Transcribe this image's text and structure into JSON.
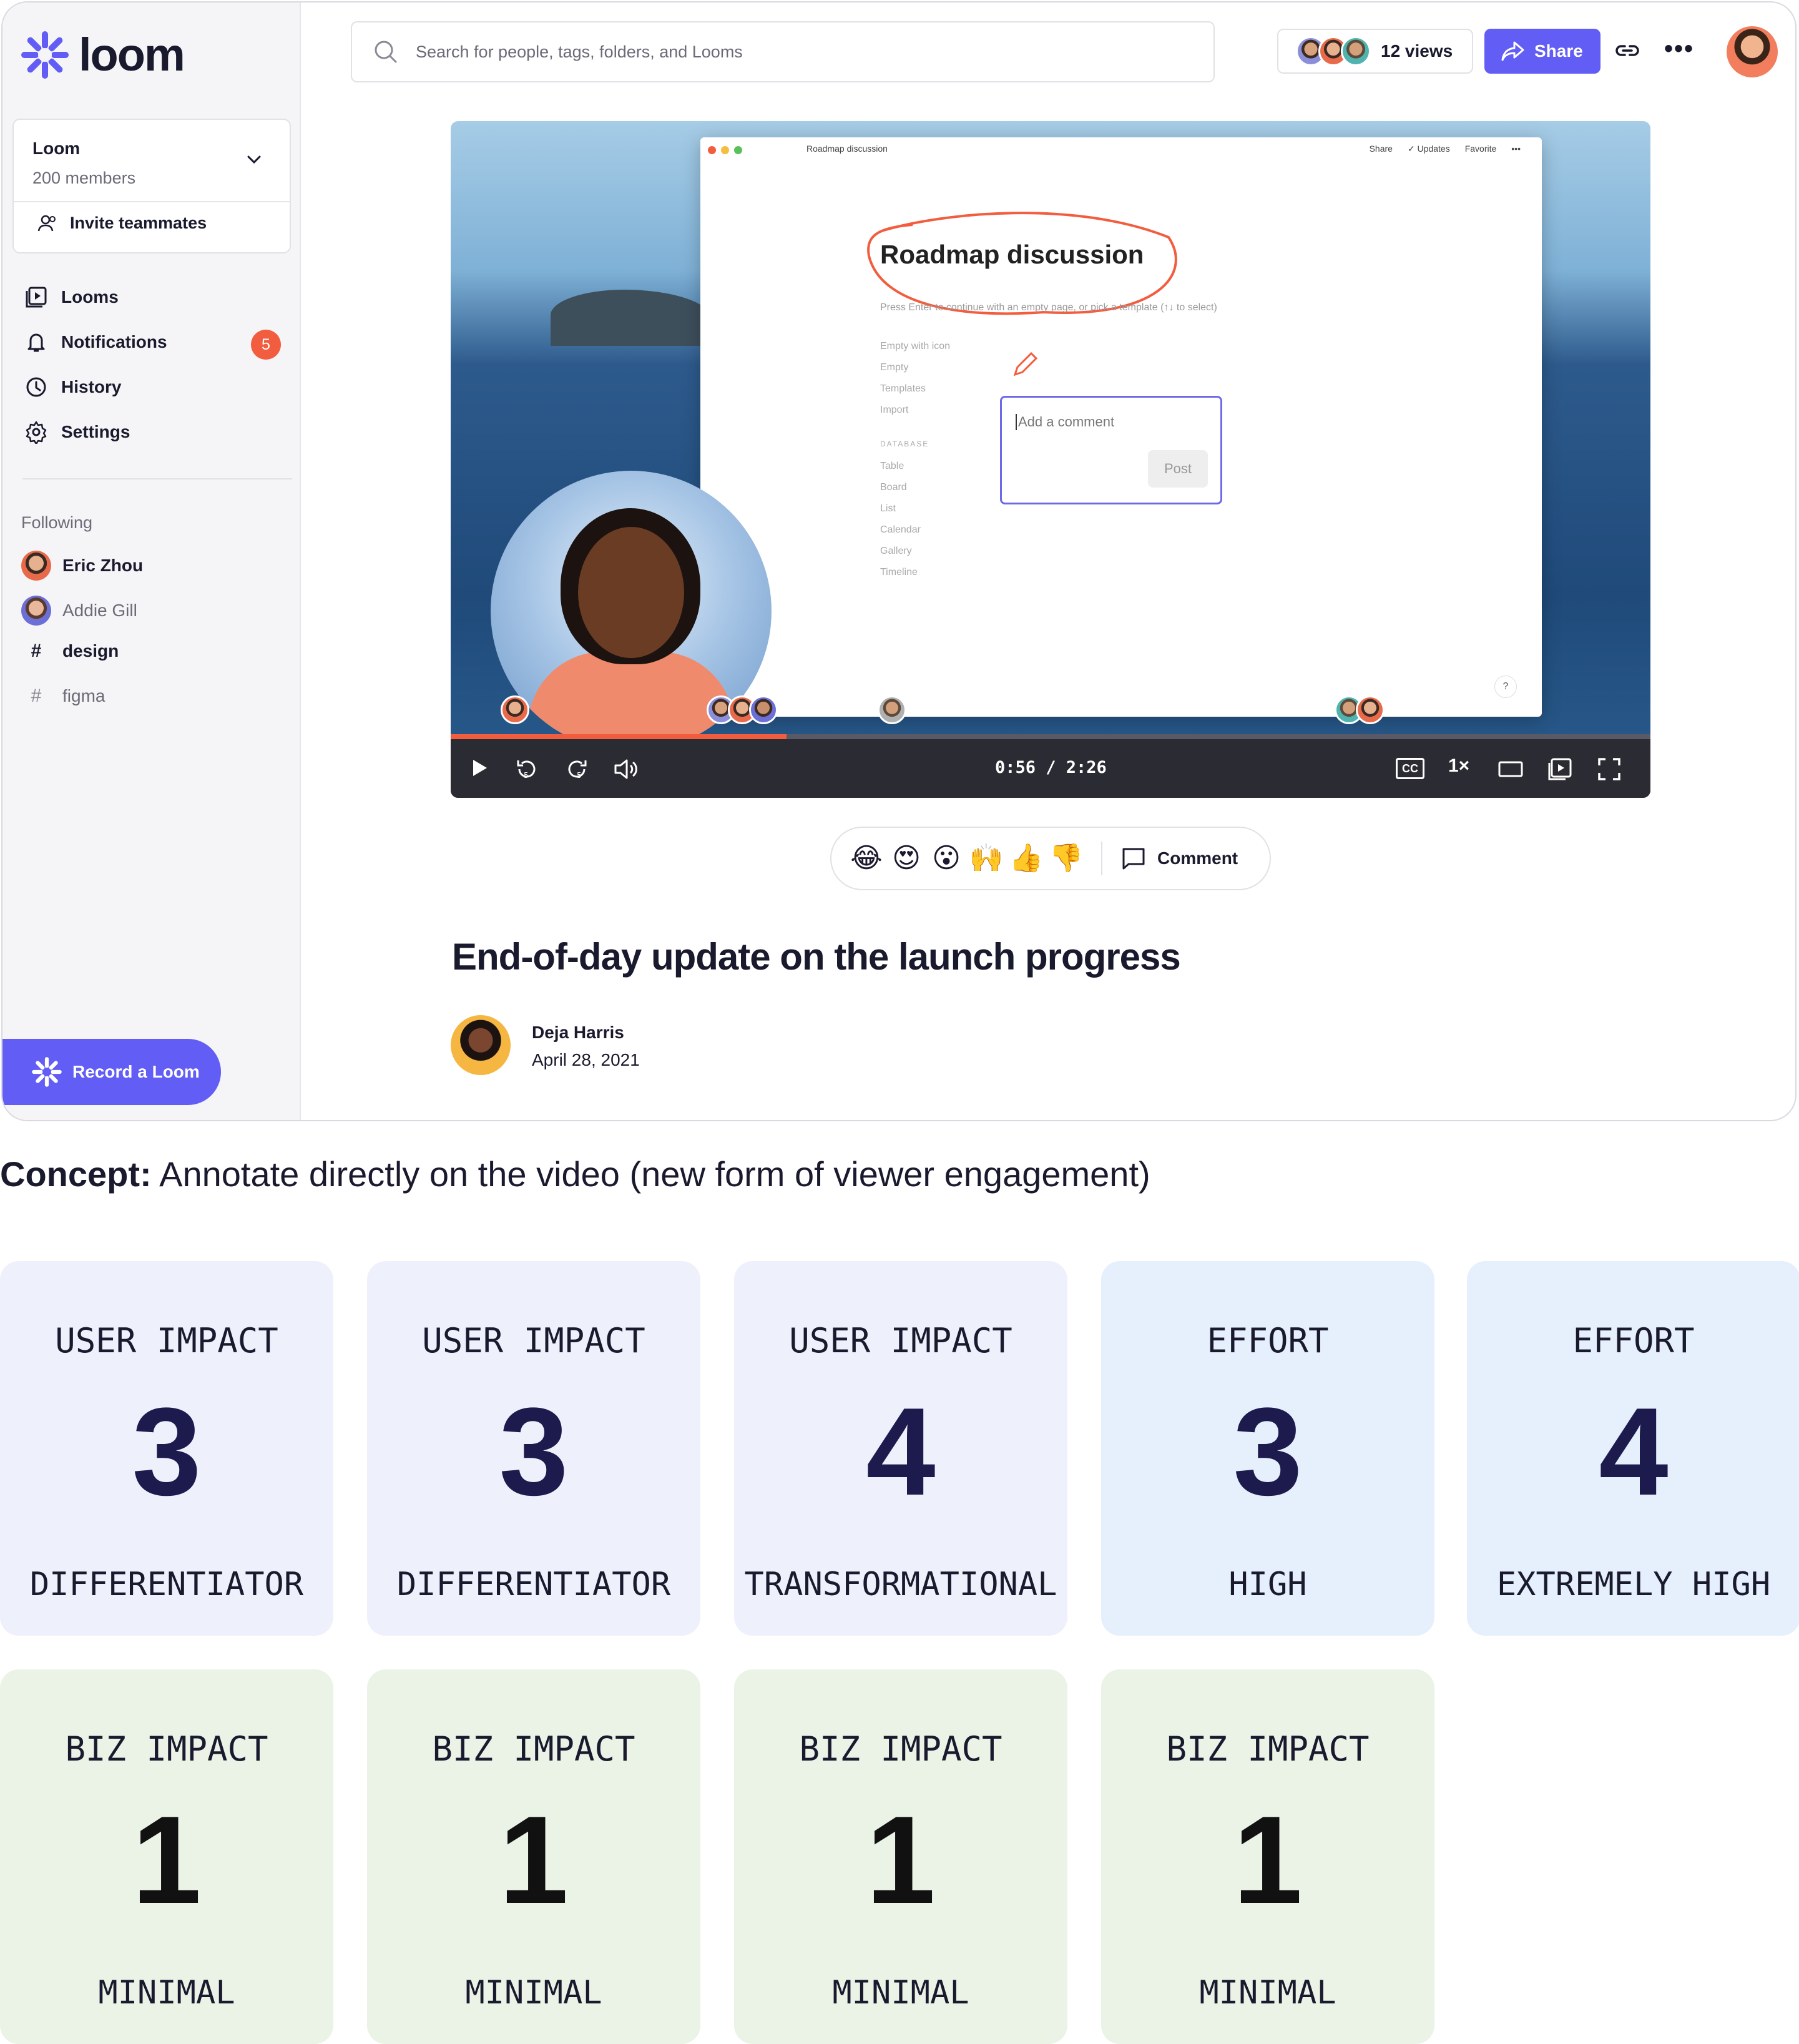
{
  "app": {
    "logo": "loom",
    "workspace": {
      "name": "Loom",
      "members": "200 members",
      "invite_label": "Invite teammates"
    },
    "nav": [
      {
        "label": "Looms",
        "icon": "looms-icon"
      },
      {
        "label": "Notifications",
        "icon": "bell-icon",
        "badge": "5"
      },
      {
        "label": "History",
        "icon": "clock-icon"
      },
      {
        "label": "Settings",
        "icon": "gear-icon"
      }
    ],
    "following": {
      "heading": "Following",
      "items": [
        {
          "label": "Eric Zhou",
          "type": "person"
        },
        {
          "label": "Addie Gill",
          "type": "person"
        },
        {
          "label": "design",
          "type": "tag"
        },
        {
          "label": "figma",
          "type": "tag"
        }
      ]
    },
    "record_label": "Record a Loom",
    "search_placeholder": "Search for people, tags, folders, and Looms",
    "views_label": "12 views",
    "share_label": "Share",
    "accent_color": "#625df5",
    "badge_color": "#f25d3f"
  },
  "video": {
    "screen": {
      "window_title": "Roadmap discussion",
      "window_actions": [
        "Share",
        "✓ Updates",
        "Favorite",
        "•••"
      ],
      "page_title": "Roadmap discussion",
      "hint": "Press Enter to continue with an empty page, or pick a template (↑↓ to select)",
      "options": [
        "Empty with icon",
        "Empty",
        "Templates",
        "Import"
      ],
      "database_heading": "DATABASE",
      "database_options": [
        "Table",
        "Board",
        "List",
        "Calendar",
        "Gallery",
        "Timeline"
      ],
      "comment_placeholder": "Add a comment",
      "post_label": "Post",
      "help": "?"
    },
    "time": "0:56 / 2:26",
    "progress": 0.28,
    "cc_label": "CC",
    "rate": "1×"
  },
  "reactions": {
    "emojis": [
      "😂",
      "😍",
      "😮",
      "🙌",
      "👍",
      "👎"
    ],
    "comment_label": "Comment"
  },
  "title": "End-of-day update on the launch progress",
  "author": {
    "name": "Deja Harris",
    "date": "April 28, 2021"
  },
  "concept": {
    "prefix": "Concept:",
    "text": " Annotate directly on the video (new form of viewer engagement)"
  },
  "cards": [
    {
      "label": "USER IMPACT",
      "value": "3",
      "caption": "DIFFERENTIATOR"
    },
    {
      "label": "USER IMPACT",
      "value": "3",
      "caption": "DIFFERENTIATOR"
    },
    {
      "label": "USER IMPACT",
      "value": "4",
      "caption": "TRANSFORMATIONAL"
    },
    {
      "label": "EFFORT",
      "value": "3",
      "caption": "HIGH"
    },
    {
      "label": "EFFORT",
      "value": "4",
      "caption": "EXTREMELY HIGH"
    },
    {
      "label": "BIZ IMPACT",
      "value": "1",
      "caption": "MINIMAL"
    },
    {
      "label": "BIZ IMPACT",
      "value": "1",
      "caption": "MINIMAL"
    },
    {
      "label": "BIZ IMPACT",
      "value": "1",
      "caption": "MINIMAL"
    },
    {
      "label": "BIZ IMPACT",
      "value": "1",
      "caption": "MINIMAL"
    }
  ]
}
